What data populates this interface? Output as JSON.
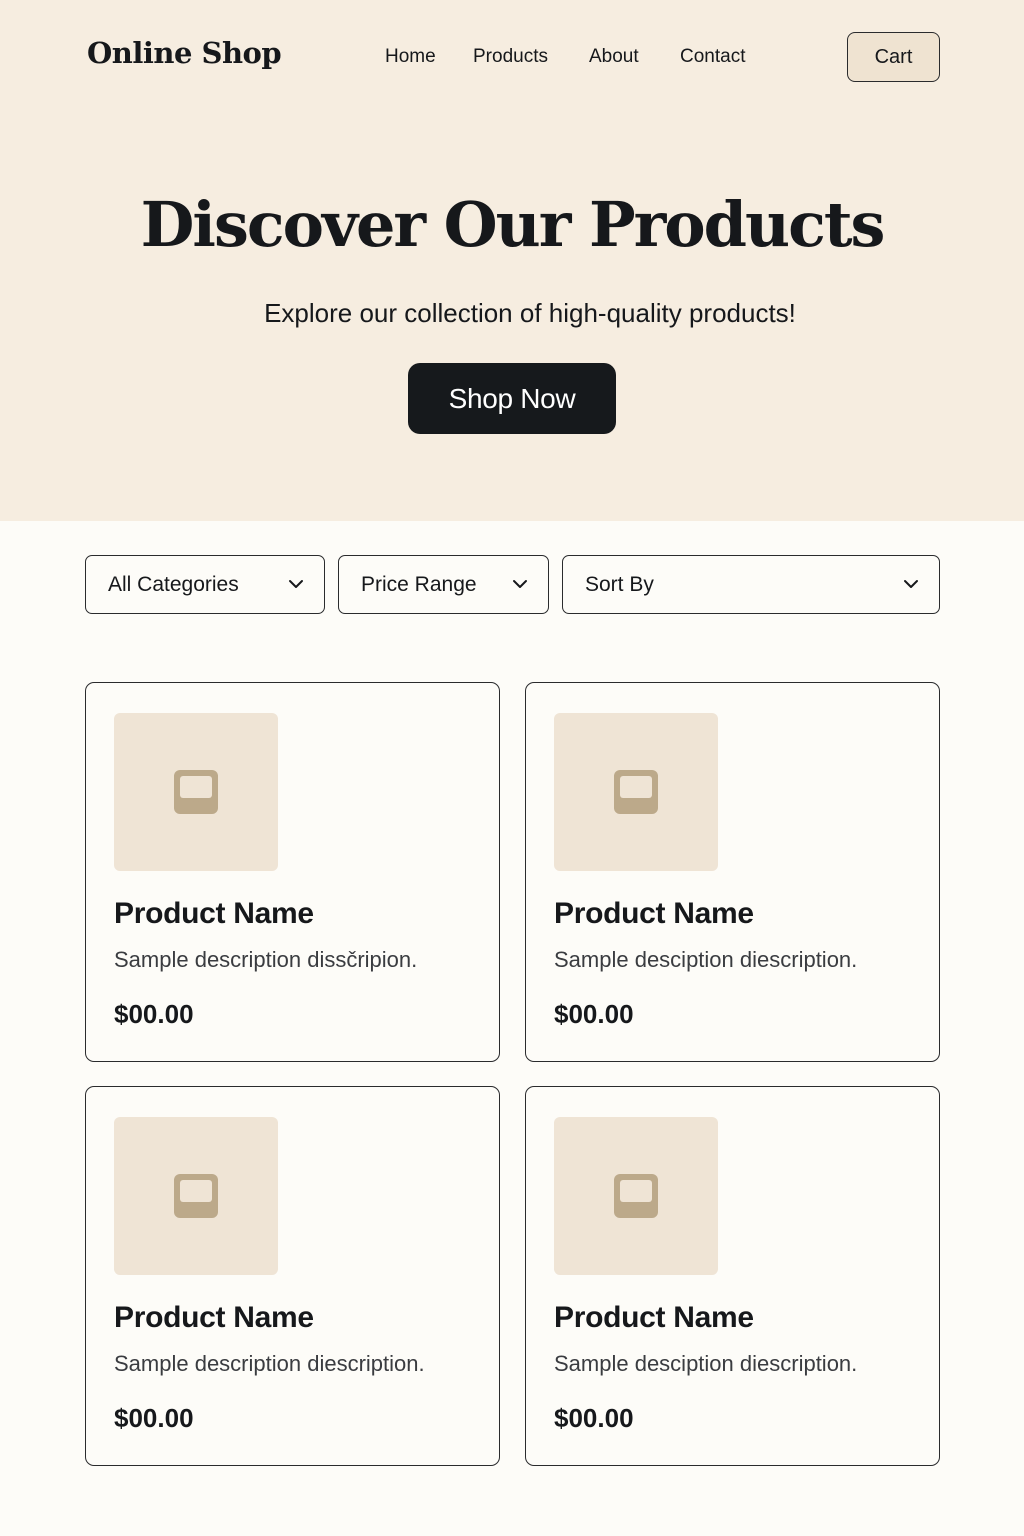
{
  "header": {
    "brand": "Online Shop",
    "nav": [
      "Home",
      "Products",
      "About",
      "Contact"
    ],
    "cart_label": "Cart"
  },
  "hero": {
    "title": "Discover Our Products",
    "subtitle": "Explore our collection of high-quality products!",
    "cta_label": "Shop Now"
  },
  "filters": {
    "category": "All Categories",
    "price": "Price Range",
    "sort": "Sort By"
  },
  "products": [
    {
      "name": "Product Name",
      "description": "Sample description dissčripion.",
      "price": "$00.00",
      "icon": "image-placeholder-icon"
    },
    {
      "name": "Product Name",
      "description": "Sample desciption diescription.",
      "price": "$00.00",
      "icon": "image-placeholder-icon"
    },
    {
      "name": "Product Name",
      "description": "Sample description diescription.",
      "price": "$00.00",
      "icon": "image-placeholder-icon"
    },
    {
      "name": "Product Name",
      "description": "Sample desciption diescription.",
      "price": "$00.00",
      "icon": "image-placeholder-icon"
    }
  ],
  "colors": {
    "hero_bg": "#f6ede0",
    "page_bg": "#fdfcf8",
    "primary_button": "#16191c",
    "thumb_bg": "#efe4d5",
    "thumb_icon": "#bca98a"
  }
}
